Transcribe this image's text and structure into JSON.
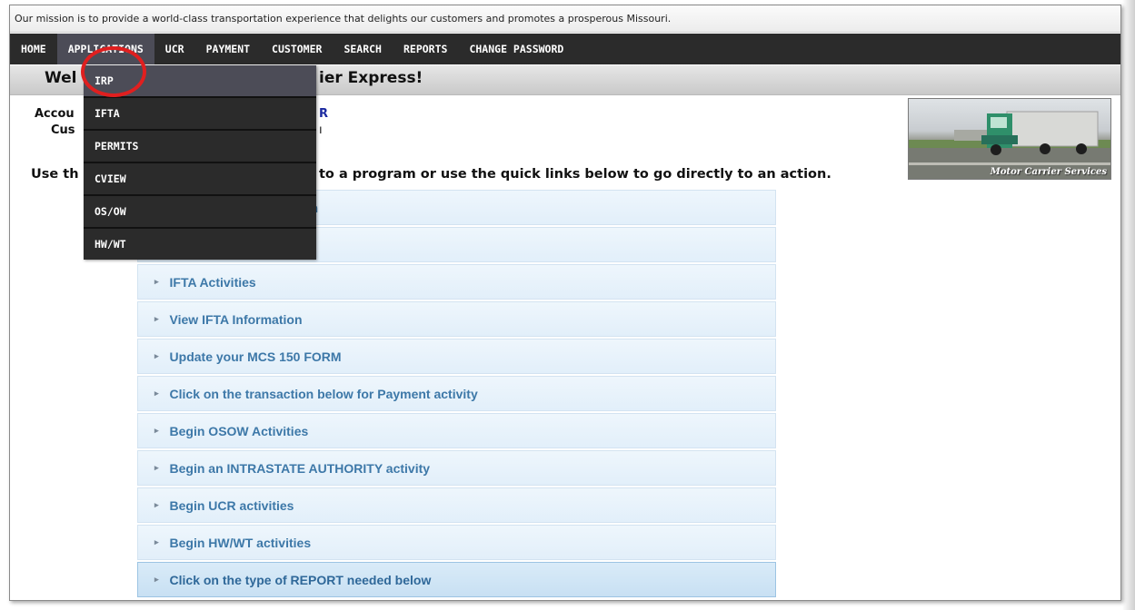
{
  "mission": "Our mission is to provide a world-class transportation experience that delights our customers and promotes a prosperous Missouri.",
  "nav": {
    "home": "HOME",
    "applications": "APPLICATIONS",
    "ucr": "UCR",
    "payment": "PAYMENT",
    "customer": "CUSTOMER",
    "search": "SEARCH",
    "reports": "REPORTS",
    "change_password": "CHANGE PASSWORD"
  },
  "dropdown": {
    "items": [
      "IRP",
      "IFTA",
      "PERMITS",
      "CVIEW",
      "OS/OW",
      "HW/WT"
    ],
    "selected": "IRP"
  },
  "welcome": {
    "left": "Wel",
    "right": "ier Express!"
  },
  "account": {
    "label_partial": "Accou",
    "value_partial": "R",
    "customer_label_partial": "Cus",
    "customer_value_partial": "ı"
  },
  "instruction": {
    "left": "Use th",
    "right": "to a program or use the quick links below to go directly to an action."
  },
  "banner": {
    "caption": "Motor Carrier Services"
  },
  "quick_links": [
    {
      "label": "n"
    },
    {
      "label": ""
    },
    {
      "label": "IFTA Activities"
    },
    {
      "label": "View IFTA Information"
    },
    {
      "label": "Update your MCS 150 FORM"
    },
    {
      "label": "Click on the transaction below for Payment activity"
    },
    {
      "label": "Begin OSOW Activities"
    },
    {
      "label": "Begin an INTRASTATE AUTHORITY activity"
    },
    {
      "label": "Begin UCR activities"
    },
    {
      "label": "Begin HW/WT activities"
    },
    {
      "label": "Click on the type of REPORT needed below"
    }
  ],
  "colors": {
    "nav_bg": "#2b2b2b",
    "nav_active": "#4c4c57",
    "link_text": "#3d78a8",
    "highlight_circle": "#e01f1f"
  }
}
